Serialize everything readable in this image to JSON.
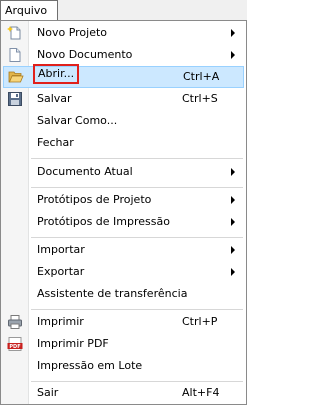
{
  "menubar": {
    "title": "Arquivo"
  },
  "menu": {
    "items": [
      {
        "label": "Novo Projeto",
        "shortcut": "",
        "submenu": true,
        "icon": "new-project-icon"
      },
      {
        "label": "Novo Documento",
        "shortcut": "",
        "submenu": true,
        "icon": "new-document-icon"
      },
      {
        "label": "Abrir...",
        "shortcut": "Ctrl+A",
        "submenu": false,
        "icon": "open-folder-icon",
        "highlighted": true
      },
      {
        "label": "Salvar",
        "shortcut": "Ctrl+S",
        "submenu": false,
        "icon": "save-icon"
      },
      {
        "label": "Salvar Como...",
        "shortcut": "",
        "submenu": false
      },
      {
        "label": "Fechar",
        "shortcut": "",
        "submenu": false
      },
      {
        "label": "Documento Atual",
        "shortcut": "",
        "submenu": true
      },
      {
        "label": "Protótipos de Projeto",
        "shortcut": "",
        "submenu": true
      },
      {
        "label": "Protótipos de Impressão",
        "shortcut": "",
        "submenu": true
      },
      {
        "label": "Importar",
        "shortcut": "",
        "submenu": true
      },
      {
        "label": "Exportar",
        "shortcut": "",
        "submenu": true
      },
      {
        "label": "Assistente de transferência",
        "shortcut": "",
        "submenu": false
      },
      {
        "label": "Imprimir",
        "shortcut": "Ctrl+P",
        "submenu": false,
        "icon": "printer-icon"
      },
      {
        "label": "Imprimir PDF",
        "shortcut": "",
        "submenu": false,
        "icon": "pdf-icon",
        "icon_text": "PDF"
      },
      {
        "label": "Impressão em Lote",
        "shortcut": "",
        "submenu": false
      },
      {
        "label": "Sair",
        "shortcut": "Alt+F4",
        "submenu": false
      }
    ]
  },
  "colors": {
    "highlight_bg": "#cce8ff",
    "highlight_border": "#99d1ff",
    "focus_box": "#e0201b",
    "gutter": "#f5f5f5"
  }
}
